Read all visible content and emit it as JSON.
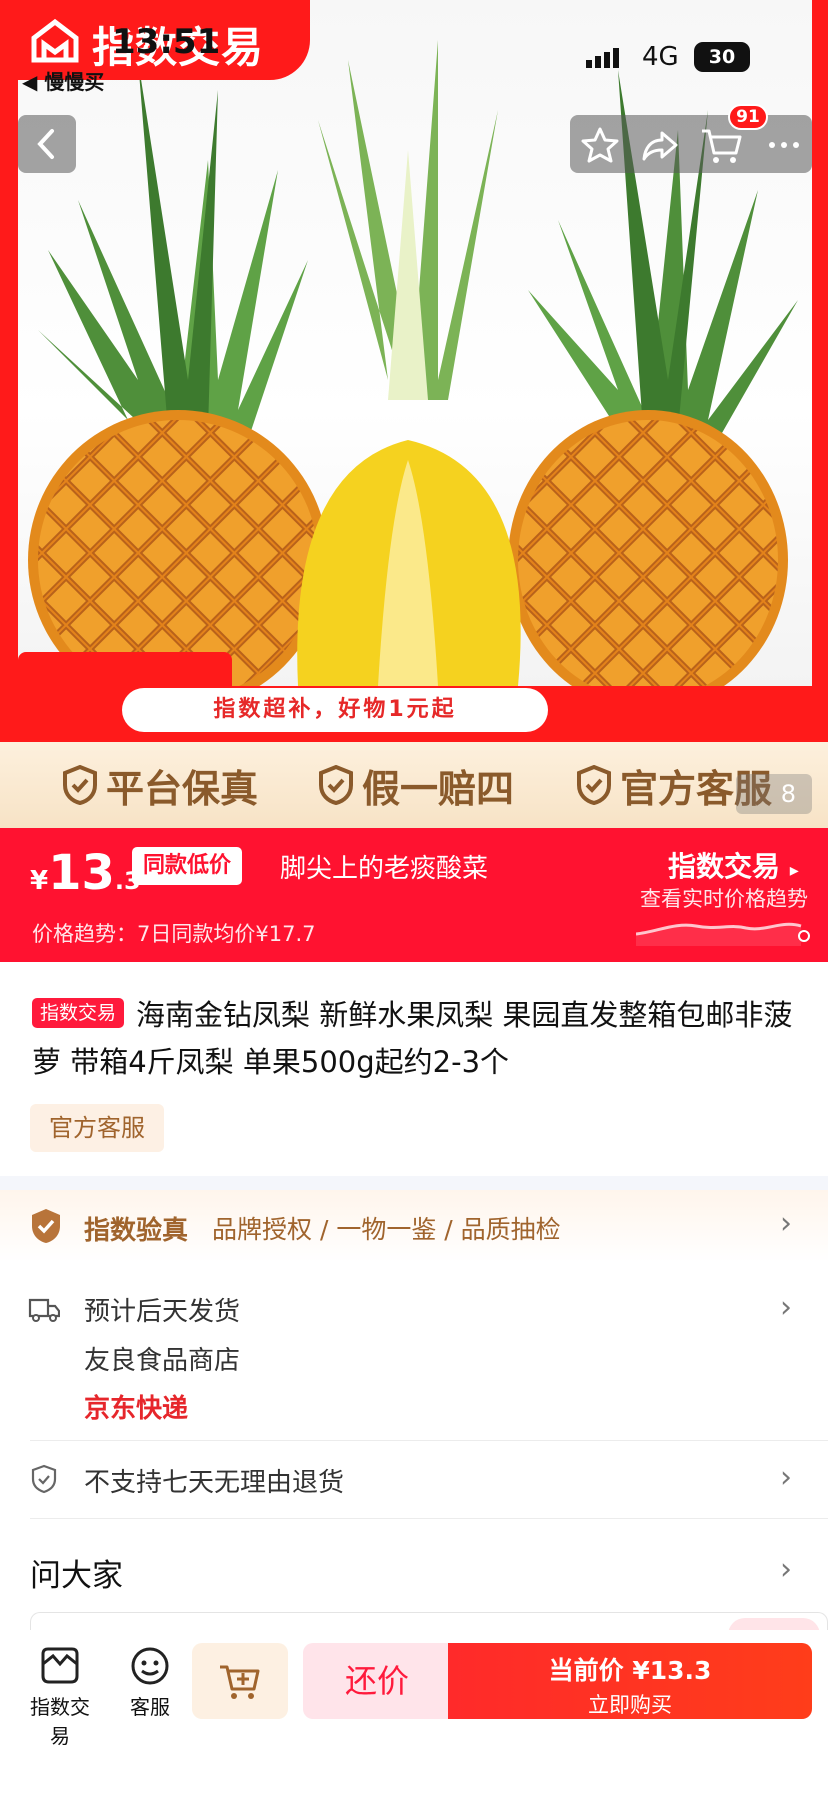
{
  "status": {
    "time": "13:51",
    "back_app": "◀ 慢慢买",
    "network": "4G",
    "battery": "30"
  },
  "hero": {
    "logo": "指数交易",
    "cart_badge": "91",
    "promo": "指数超补，好物1元起",
    "page_indicator": "8"
  },
  "guarantees": [
    "平台保真",
    "假一赔四",
    "官方客服"
  ],
  "price": {
    "currency": "¥",
    "integer": "13",
    "decimal": ".3",
    "tag": "同款低价",
    "slogan": "脚尖上的老痰酸菜",
    "trend_label": "价格趋势：7日同款均价¥17.7",
    "brand_link": "指数交易",
    "view_trend": "查看实时价格趋势"
  },
  "product": {
    "tag": "指数交易",
    "title": "海南金钻凤梨 新鲜水果凤梨 果园直发整箱包邮非菠萝 带箱4斤凤梨 单果500g起约2-3个",
    "service_tag": "官方客服"
  },
  "verify": {
    "title": "指数验真",
    "desc": "品牌授权 / 一物一鉴 / 品质抽检"
  },
  "shipping": {
    "eta": "预计后天发货",
    "store": "友良食品商店",
    "courier": "京东快递"
  },
  "returns": {
    "text": "不支持七天无理由退货"
  },
  "ask": {
    "title": "问大家"
  },
  "bottom_bar": {
    "home_label": "指数交易",
    "service_label": "客服",
    "bargain_label": "还价",
    "buy_price": "当前价 ¥13.3",
    "buy_label": "立即购买"
  },
  "colors": {
    "brand_red": "#ff1a1a",
    "price_bar": "#ff1230",
    "gold_text": "#8a5a2b",
    "courier_red": "#e6262b"
  }
}
